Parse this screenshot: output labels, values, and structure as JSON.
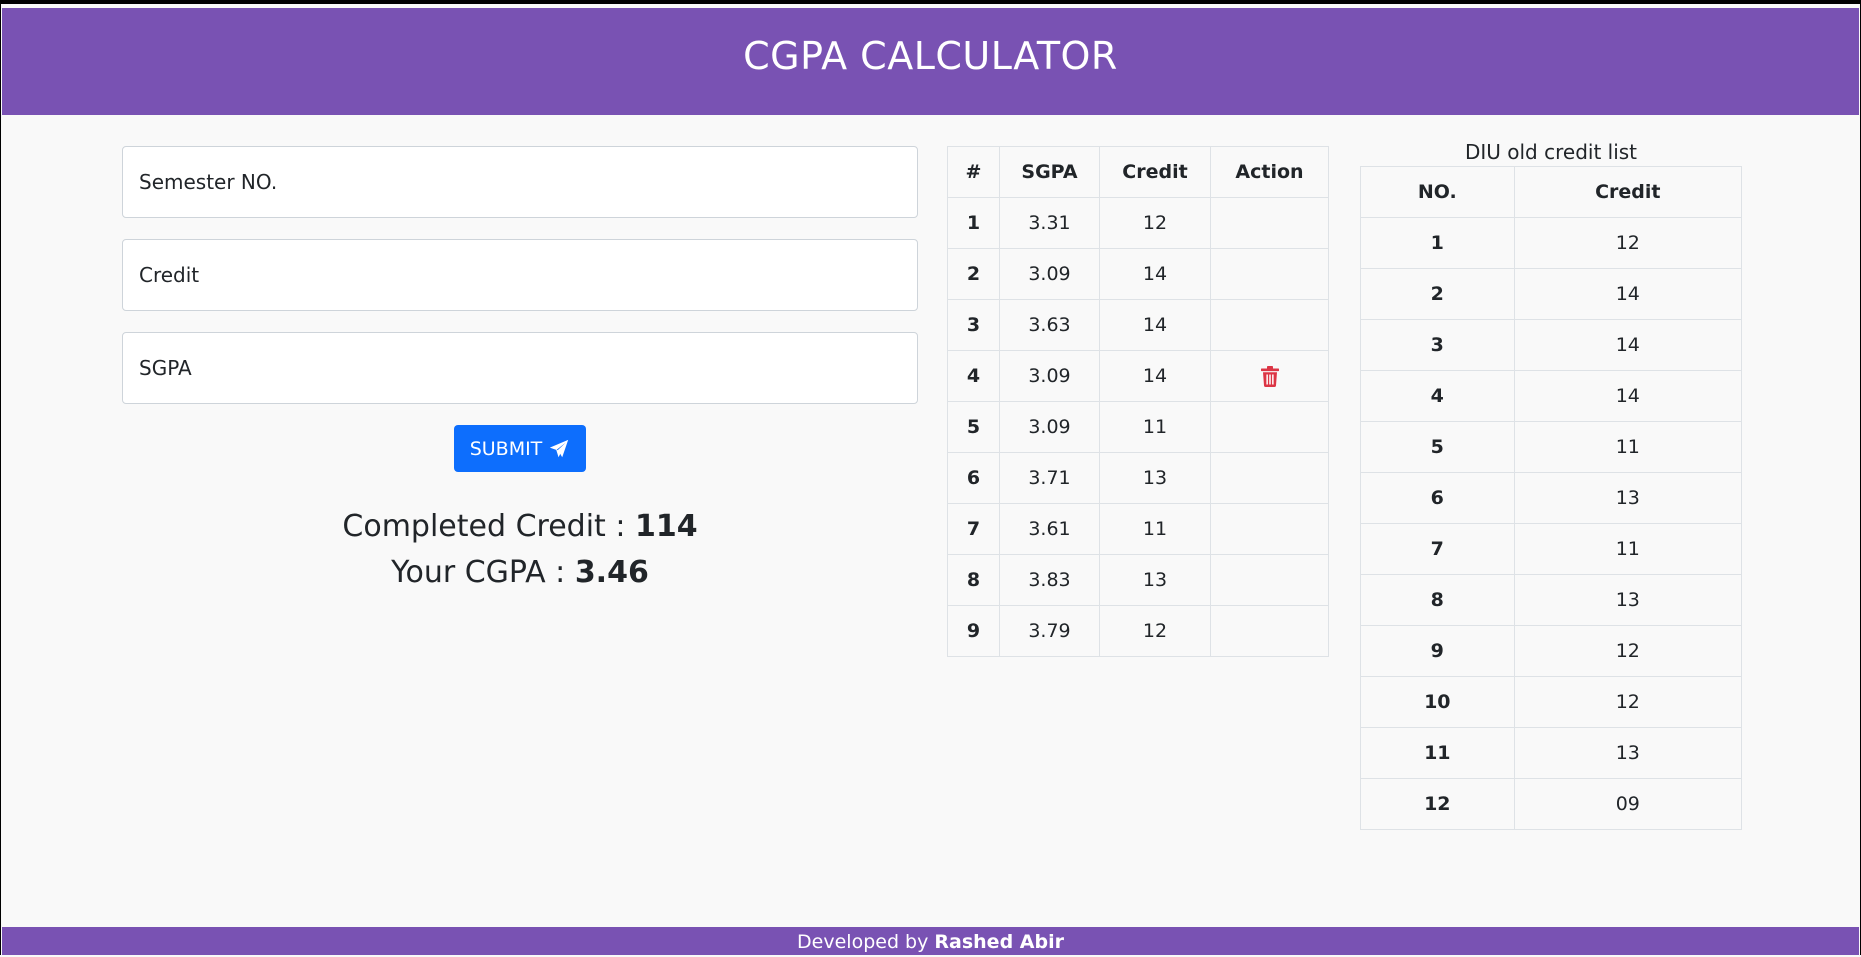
{
  "header": {
    "title": "CGPA CALCULATOR"
  },
  "form": {
    "semester_placeholder": "Semester NO.",
    "credit_placeholder": "Credit",
    "sgpa_placeholder": "SGPA",
    "submit_label": "SUBMIT"
  },
  "result": {
    "completed_credit_label": "Completed Credit : ",
    "completed_credit_value": "114",
    "cgpa_label": "Your CGPA : ",
    "cgpa_value": "3.46"
  },
  "semester_table": {
    "headers": [
      "#",
      "SGPA",
      "Credit",
      "Action"
    ],
    "rows": [
      {
        "no": "1",
        "sgpa": "3.31",
        "credit": "12",
        "action": ""
      },
      {
        "no": "2",
        "sgpa": "3.09",
        "credit": "14",
        "action": ""
      },
      {
        "no": "3",
        "sgpa": "3.63",
        "credit": "14",
        "action": ""
      },
      {
        "no": "4",
        "sgpa": "3.09",
        "credit": "14",
        "action": "trash-icon"
      },
      {
        "no": "5",
        "sgpa": "3.09",
        "credit": "11",
        "action": ""
      },
      {
        "no": "6",
        "sgpa": "3.71",
        "credit": "13",
        "action": ""
      },
      {
        "no": "7",
        "sgpa": "3.61",
        "credit": "11",
        "action": ""
      },
      {
        "no": "8",
        "sgpa": "3.83",
        "credit": "13",
        "action": ""
      },
      {
        "no": "9",
        "sgpa": "3.79",
        "credit": "12",
        "action": ""
      }
    ]
  },
  "credit_list": {
    "caption": "DIU old credit list",
    "headers": [
      "NO.",
      "Credit"
    ],
    "rows": [
      {
        "no": "1",
        "credit": "12"
      },
      {
        "no": "2",
        "credit": "14"
      },
      {
        "no": "3",
        "credit": "14"
      },
      {
        "no": "4",
        "credit": "14"
      },
      {
        "no": "5",
        "credit": "11"
      },
      {
        "no": "6",
        "credit": "13"
      },
      {
        "no": "7",
        "credit": "11"
      },
      {
        "no": "8",
        "credit": "13"
      },
      {
        "no": "9",
        "credit": "12"
      },
      {
        "no": "10",
        "credit": "12"
      },
      {
        "no": "11",
        "credit": "13"
      },
      {
        "no": "12",
        "credit": "09"
      }
    ]
  },
  "footer": {
    "prefix": "Developed by ",
    "author": "Rashed Abir"
  },
  "colors": {
    "brand": "#7952b3",
    "primary_button": "#0d6efd",
    "danger": "#dc3545"
  }
}
